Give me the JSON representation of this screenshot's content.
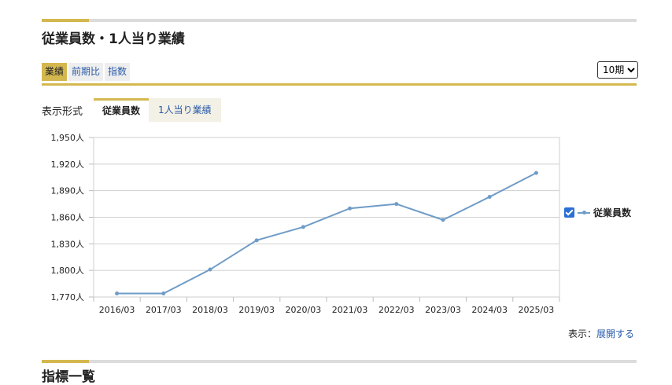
{
  "section": {
    "title": "従業員数・1人当り業績"
  },
  "tabs": [
    {
      "label": "業績",
      "active": true
    },
    {
      "label": "前期比",
      "active": false
    },
    {
      "label": "指数",
      "active": false
    }
  ],
  "period_select": {
    "selected": "10期"
  },
  "format": {
    "label": "表示形式",
    "tabs": [
      {
        "label": "従業員数",
        "active": true
      },
      {
        "label": "1人当り業績",
        "active": false
      }
    ]
  },
  "legend": {
    "series_label": "従業員数",
    "checked": true
  },
  "display": {
    "prefix": "表示：",
    "link": "展開する"
  },
  "next_section": {
    "title": "指標一覧"
  },
  "colors": {
    "accent": "#d4b84f",
    "series": "#6f9cc7",
    "link": "#2a5aa8"
  },
  "chart_data": {
    "type": "line",
    "categories": [
      "2016/03",
      "2017/03",
      "2018/03",
      "2019/03",
      "2020/03",
      "2021/03",
      "2022/03",
      "2023/03",
      "2024/03",
      "2025/03"
    ],
    "series": [
      {
        "name": "従業員数",
        "values": [
          1774,
          1774,
          1801,
          1834,
          1849,
          1870,
          1875,
          1857,
          1883,
          1910
        ]
      }
    ],
    "ylim": [
      1770,
      1950
    ],
    "yticks": [
      1770,
      1800,
      1830,
      1860,
      1890,
      1920,
      1950
    ],
    "ytick_labels": [
      "1,770人",
      "1,800人",
      "1,830人",
      "1,860人",
      "1,890人",
      "1,920人",
      "1,950人"
    ],
    "grid": true,
    "legend_position": "right"
  }
}
